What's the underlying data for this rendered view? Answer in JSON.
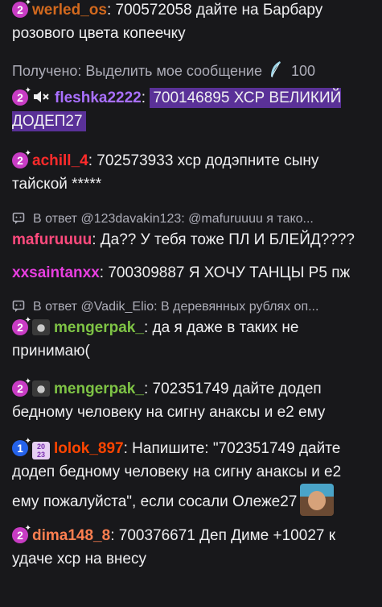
{
  "colors": {
    "background": "#18181b",
    "text": "#efeff1",
    "muted": "#adadb8",
    "highlight": "#9147ff",
    "sub_badge": "#c83cc4"
  },
  "messages": [
    {
      "badge": "2",
      "user": "werled_os",
      "user_color": "#d2691e",
      "sep": ":",
      "text": " 700572058 дайте на Барбару розового цвета копеечку"
    },
    {
      "type": "reward",
      "label": "Получено: Выделить мое сообщение",
      "cost": "100"
    },
    {
      "badge": "2",
      "user": "fleshka2222",
      "user_color": "#a970ff",
      "sep": ":",
      "text": "700146895 ХСР ВЕЛИКИЙ ДОДЕП27",
      "highlighted": true
    },
    {
      "badge": "2",
      "user": "achill_4",
      "user_color": "#ff2b2b",
      "sep": ":",
      "text": " 702573933 хср додэпните сыну тайской *****"
    },
    {
      "type": "reply",
      "text": "В ответ @123davakin123: @mafuruuuu я тако..."
    },
    {
      "user": "mafuruuuu",
      "user_color": "#ff4a7d",
      "sep": ":",
      "text": " Да?? У тебя тоже ПЛ И БЛЕЙД????"
    },
    {
      "user": "xxsaintanxx",
      "user_color": "#e83ee0",
      "sep": ":",
      "text": " 700309887 Я ХОЧУ ТАНЦЫ Р5 пж"
    },
    {
      "type": "reply",
      "text": "В ответ @Vadik_Elio: В деревянных рублях оп..."
    },
    {
      "badge": "2",
      "user": "mengerpak_",
      "user_color": "#7ec345",
      "sep": ":",
      "text": " да я даже в таких не принимаю("
    },
    {
      "badge": "2",
      "user": "mengerpak_",
      "user_color": "#7ec345",
      "sep": ":",
      "text": " 702351749 дайте додеп бедному человеку на сигну анаксы и е2 ему"
    },
    {
      "badge": "1",
      "user": "lolok_897",
      "user_color": "#ff4500",
      "sep": ":",
      "text": " Напишите: \"702351749 дайте додеп бедному человеку на сигну анаксы и е2 ему пожалуйста\", если сосали Олеже27"
    },
    {
      "badge": "2",
      "user": "dima148_8",
      "user_color": "#ff7f50",
      "sep": ":",
      "text": " 700376671 Деп Диме +10027 к удаче хср на внесу"
    }
  ],
  "grid_badge_text": "2023"
}
